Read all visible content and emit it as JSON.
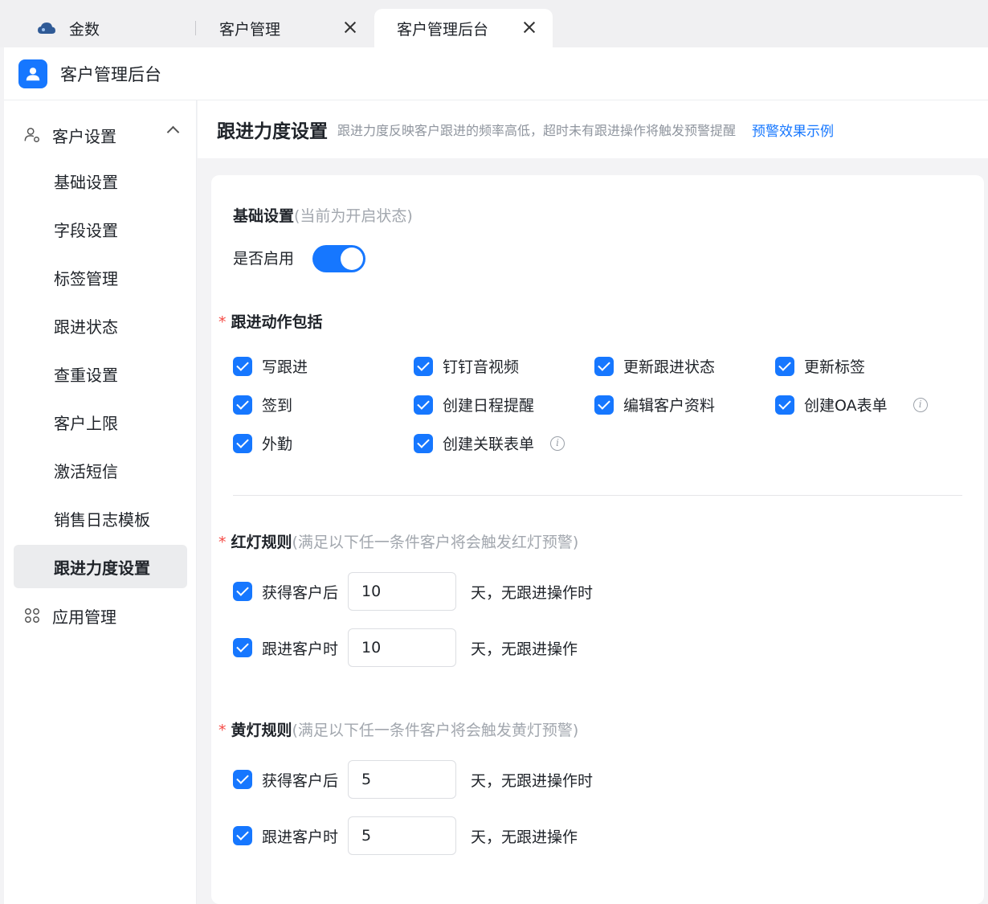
{
  "tabs": [
    {
      "label": "金数",
      "icon": "cloud-icon"
    },
    {
      "label": "客户管理"
    },
    {
      "label": "客户管理后台"
    }
  ],
  "app": {
    "title": "客户管理后台",
    "icon": "user-icon"
  },
  "sidebar": {
    "group_customer": "客户设置",
    "items": [
      "基础设置",
      "字段设置",
      "标签管理",
      "跟进状态",
      "查重设置",
      "客户上限",
      "激活短信",
      "销售日志模板",
      "跟进力度设置"
    ],
    "active": "跟进力度设置",
    "group_app": "应用管理"
  },
  "page": {
    "title": "跟进力度设置",
    "desc": "跟进力度反映客户跟进的频率高低，超时未有跟进操作将触发预警提醒",
    "link": "预警效果示例"
  },
  "basic": {
    "title": "基础设置",
    "hint": "(当前为开启状态)",
    "switch_label": "是否启用",
    "enabled": true
  },
  "actions": {
    "title": "跟进动作包括",
    "items": [
      "写跟进",
      "钉钉音视频",
      "更新跟进状态",
      "更新标签",
      "签到",
      "创建日程提醒",
      "编辑客户资料",
      "创建OA表单",
      "外勤",
      "创建关联表单"
    ]
  },
  "red_rule": {
    "title": "红灯规则",
    "hint": "(满足以下任一条件客户将会触发红灯预警)",
    "rows": [
      {
        "label": "获得客户后",
        "value": "10",
        "suffix": "天，无跟进操作时"
      },
      {
        "label": "跟进客户时",
        "value": "10",
        "suffix": "天，无跟进操作"
      }
    ]
  },
  "yellow_rule": {
    "title": "黄灯规则",
    "hint": "(满足以下任一条件客户将会触发黄灯预警)",
    "rows": [
      {
        "label": "获得客户后",
        "value": "5",
        "suffix": "天，无跟进操作时"
      },
      {
        "label": "跟进客户时",
        "value": "5",
        "suffix": "天，无跟进操作"
      }
    ]
  },
  "colors": {
    "accent": "#1677ff",
    "required": "#f54a45"
  }
}
